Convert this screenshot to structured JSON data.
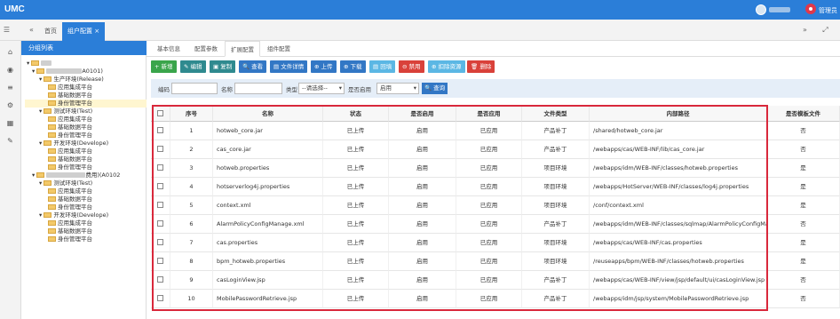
{
  "app": {
    "brand": "UMC",
    "admin_label": "管理员"
  },
  "tabs": [
    {
      "label": "首页"
    },
    {
      "label": "组户配置"
    }
  ],
  "tree": {
    "header": "分组列表",
    "nodes": [
      {
        "label": "A0101)"
      },
      {
        "label": "生产环境(Release)"
      },
      {
        "label": "应用集成平台"
      },
      {
        "label": "基础数据平台"
      },
      {
        "label": "身份管理平台"
      },
      {
        "label": "测试环境(Test)"
      },
      {
        "label": "应用集成平台"
      },
      {
        "label": "基础数据平台"
      },
      {
        "label": "身份管理平台"
      },
      {
        "label": "开发环境(Develope)"
      },
      {
        "label": "应用集成平台"
      },
      {
        "label": "基础数据平台"
      },
      {
        "label": "身份管理平台"
      },
      {
        "label": "费用)(A0102"
      },
      {
        "label": "测试环境(Test)"
      },
      {
        "label": "应用集成平台"
      },
      {
        "label": "基础数据平台"
      },
      {
        "label": "身份管理平台"
      },
      {
        "label": "开发环境(Develope)"
      },
      {
        "label": "应用集成平台"
      },
      {
        "label": "基础数据平台"
      },
      {
        "label": "身份管理平台"
      }
    ]
  },
  "subtabs": [
    {
      "label": "基本信息"
    },
    {
      "label": "配置参数"
    },
    {
      "label": "扩展配置"
    },
    {
      "label": "组件配置"
    }
  ],
  "toolbar": [
    {
      "label": "+ 新增",
      "color": "#3aa54b"
    },
    {
      "label": "✎ 编辑",
      "color": "#2f8a8f"
    },
    {
      "label": "▣ 复制",
      "color": "#2f8a8f"
    },
    {
      "label": "🔍 查看",
      "color": "#3277c5"
    },
    {
      "label": "▤ 文件详情",
      "color": "#3277c5"
    },
    {
      "label": "⊕ 上传",
      "color": "#3277c5"
    },
    {
      "label": "⊕ 下载",
      "color": "#3277c5"
    },
    {
      "label": "▤ 回填",
      "color": "#5bb7e4"
    },
    {
      "label": "⊖ 禁用",
      "color": "#d9413a"
    },
    {
      "label": "⊕ 扣除资源",
      "color": "#5bb7e4"
    },
    {
      "label": "🗑 删除",
      "color": "#d9413a"
    }
  ],
  "filter": {
    "code_label": "编码",
    "name_label": "名称",
    "type_label": "类型",
    "type_value": "--请选择--",
    "enabled_label": "是否启用",
    "enabled_value": "启用",
    "query_label": "🔍 查询"
  },
  "table": {
    "headers": [
      "序号",
      "名称",
      "状态",
      "是否启用",
      "是否应用",
      "文件类型",
      "内部路径",
      "是否模板文件"
    ],
    "rows": [
      [
        "1",
        "hotweb_core.jar",
        "已上传",
        "启用",
        "已应用",
        "产品补丁",
        "/shared/hotweb_core.jar",
        "否"
      ],
      [
        "2",
        "cas_core.jar",
        "已上传",
        "启用",
        "已应用",
        "产品补丁",
        "/webapps/cas/WEB-INF/lib/cas_core.jar",
        "否"
      ],
      [
        "3",
        "hotweb.properties",
        "已上传",
        "启用",
        "已应用",
        "项目环境",
        "/webapps/idm/WEB-INF/classes/hotweb.properties",
        "是"
      ],
      [
        "4",
        "hotserverlog4j.properties",
        "已上传",
        "启用",
        "已应用",
        "项目环境",
        "/webapps/HotServer/WEB-INF/classes/log4j.properties",
        "是"
      ],
      [
        "5",
        "context.xml",
        "已上传",
        "启用",
        "已应用",
        "项目环境",
        "/conf/context.xml",
        "是"
      ],
      [
        "6",
        "AlarmPolicyConfigManage.xml",
        "已上传",
        "启用",
        "已应用",
        "产品补丁",
        "/webapps/idm/WEB-INF/classes/sqlmap/AlarmPolicyConfigManag",
        "否"
      ],
      [
        "7",
        "cas.properties",
        "已上传",
        "启用",
        "已应用",
        "项目环境",
        "/webapps/cas/WEB-INF/cas.properties",
        "是"
      ],
      [
        "8",
        "bpm_hotweb.properties",
        "已上传",
        "启用",
        "已应用",
        "项目环境",
        "/reuseapps/bpm/WEB-INF/classes/hotweb.properties",
        "是"
      ],
      [
        "9",
        "casLoginView.jsp",
        "已上传",
        "启用",
        "已应用",
        "产品补丁",
        "/webapps/cas/WEB-INF/view/jsp/default/ui/casLoginView.jsp",
        "否"
      ],
      [
        "10",
        "MobilePasswordRetrieve.jsp",
        "已上传",
        "启用",
        "已应用",
        "产品补丁",
        "/webapps/idm/jsp/system/MobilePasswordRetrieve.jsp",
        "否"
      ]
    ]
  }
}
